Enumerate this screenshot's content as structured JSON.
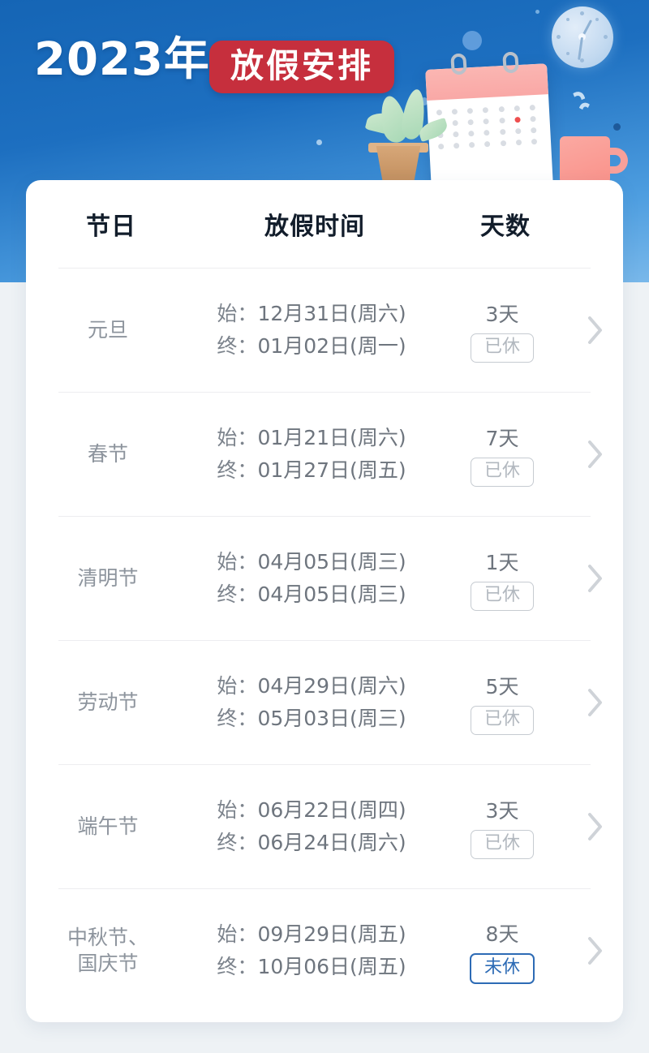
{
  "banner": {
    "year_text": "2023年",
    "badge_text": "放假安排",
    "icons": [
      "clock-icon",
      "calendar-icon",
      "plant-icon",
      "mug-icon"
    ],
    "colors": {
      "bg_top": "#1565b5",
      "bg_bottom": "#79b8ea",
      "badge_red": "#c62f3d",
      "calendar_header_pink": "#fbb6b2",
      "calendar_highlight_red": "#ee4f4f",
      "mug_pink": "#fba9a2",
      "leaf_green": "#a7d8b5",
      "pot_tan": "#c08d5d"
    }
  },
  "page": {
    "background": "#eef2f5",
    "card_background": "#ffffff"
  },
  "table": {
    "headers": {
      "holiday": "节日",
      "time": "放假时间",
      "days": "天数"
    },
    "labels": {
      "start_prefix": "始：",
      "end_prefix": "终：",
      "chevron": "chevron-right-icon"
    },
    "badge_colors": {
      "taken_border": "#c6cbd1",
      "taken_text": "#b2b8bf",
      "pending_border": "#2d6bb5",
      "pending_text": "#2d6bb5"
    },
    "rows": [
      {
        "name": "元旦",
        "name_line1": "元旦",
        "name_line2": "",
        "start": "12月31日(周六)",
        "end": "01月02日(周一)",
        "days": "3天",
        "status": "已休",
        "status_type": "taken"
      },
      {
        "name": "春节",
        "name_line1": "春节",
        "name_line2": "",
        "start": "01月21日(周六)",
        "end": "01月27日(周五)",
        "days": "7天",
        "status": "已休",
        "status_type": "taken"
      },
      {
        "name": "清明节",
        "name_line1": "清明节",
        "name_line2": "",
        "start": "04月05日(周三)",
        "end": "04月05日(周三)",
        "days": "1天",
        "status": "已休",
        "status_type": "taken"
      },
      {
        "name": "劳动节",
        "name_line1": "劳动节",
        "name_line2": "",
        "start": "04月29日(周六)",
        "end": "05月03日(周三)",
        "days": "5天",
        "status": "已休",
        "status_type": "taken"
      },
      {
        "name": "端午节",
        "name_line1": "端午节",
        "name_line2": "",
        "start": "06月22日(周四)",
        "end": "06月24日(周六)",
        "days": "3天",
        "status": "已休",
        "status_type": "taken"
      },
      {
        "name": "中秋节、国庆节",
        "name_line1": "中秋节、",
        "name_line2": "国庆节",
        "start": "09月29日(周五)",
        "end": "10月06日(周五)",
        "days": "8天",
        "status": "未休",
        "status_type": "pending"
      }
    ]
  }
}
